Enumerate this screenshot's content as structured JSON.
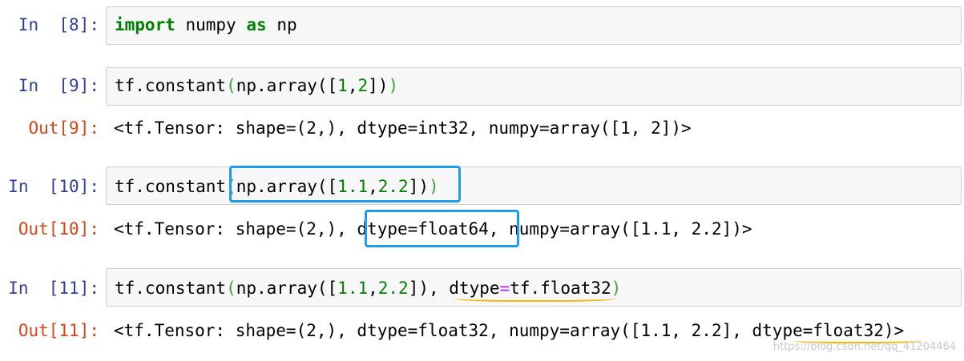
{
  "cells": [
    {
      "in_prompt": "In  [8]:",
      "code": {
        "kw1": "import",
        "t1": " numpy ",
        "kw2": "as",
        "t2": " np"
      }
    },
    {
      "in_prompt": "In  [9]:",
      "code": {
        "t1": "tf.constant",
        "p1": "(",
        "t2": "np.array([",
        "n1": "1",
        "c1": ",",
        "n2": "2",
        "t3": "])",
        "p2": ")"
      },
      "out_prompt": "Out[9]:",
      "output": "<tf.Tensor: shape=(2,), dtype=int32, numpy=array([1, 2])>"
    },
    {
      "in_prompt": "In  [10]:",
      "code": {
        "t1": "tf.constant",
        "p1": "(",
        "t2": "np.array([",
        "n1": "1.1",
        "c1": ",",
        "n2": "2.2",
        "t3": "])",
        "p2": ")"
      },
      "out_prompt": "Out[10]:",
      "output_pre": "<tf.Tensor: shape=(2,), ",
      "output_hl": "dtype=float64,",
      "output_post": " numpy=array([1.1, 2.2])>"
    },
    {
      "in_prompt": "In  [11]:",
      "code": {
        "t1": "tf.constant",
        "p1": "(",
        "t2": "np.array([",
        "n1": "1.1",
        "c1": ",",
        "n2": "2.2",
        "t3": "]), ",
        "t4": "dtype",
        "op": "=",
        "t5": "tf.float32",
        "p2": ")"
      },
      "out_prompt": "Out[11]:",
      "output": "<tf.Tensor: shape=(2,), dtype=float32, numpy=array([1.1, 2.2], dtype=float32)>"
    }
  ],
  "watermark": "https://blog.csdn.net/qq_41204464",
  "colors": {
    "in_prompt": "#303f9f",
    "out_prompt": "#d84315",
    "keyword": "#008000",
    "highlight_box": "#1e9be9",
    "underline": "#f5b700"
  }
}
